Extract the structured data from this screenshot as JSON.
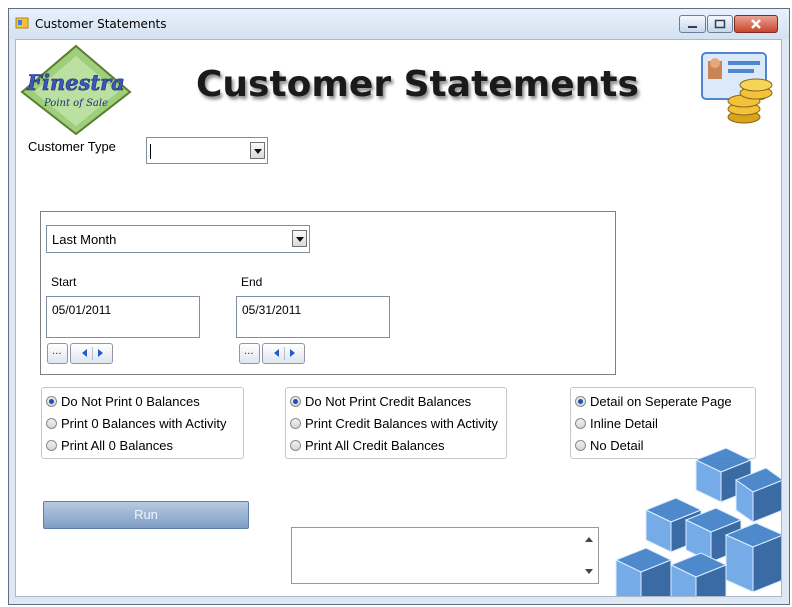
{
  "window": {
    "title": "Customer Statements"
  },
  "logo": {
    "line1": "Finestra",
    "line2": "Point of Sale"
  },
  "header": {
    "title": "Customer Statements"
  },
  "customer_type": {
    "label": "Customer Type",
    "value": ""
  },
  "date_range": {
    "preset": "Last Month",
    "start_label": "Start",
    "end_label": "End",
    "start_value": "05/01/2011",
    "end_value": "05/31/2011"
  },
  "zero_balance_options": [
    {
      "label": "Do Not Print 0 Balances",
      "checked": true
    },
    {
      "label": "Print 0 Balances with Activity",
      "checked": false
    },
    {
      "label": "Print All 0 Balances",
      "checked": false
    }
  ],
  "credit_balance_options": [
    {
      "label": "Do Not Print Credit Balances",
      "checked": true
    },
    {
      "label": "Print Credit Balances with Activity",
      "checked": false
    },
    {
      "label": "Print All Credit Balances",
      "checked": false
    }
  ],
  "detail_options": [
    {
      "label": "Detail on Seperate Page",
      "checked": true
    },
    {
      "label": "Inline Detail",
      "checked": false
    },
    {
      "label": "No Detail",
      "checked": false
    }
  ],
  "run_button": {
    "label": "Run"
  },
  "log": {
    "value": ""
  },
  "colors": {
    "accent": "#1f4fb8",
    "run_button": "#8fa9cc",
    "titlebar": "#dbe6f3"
  }
}
